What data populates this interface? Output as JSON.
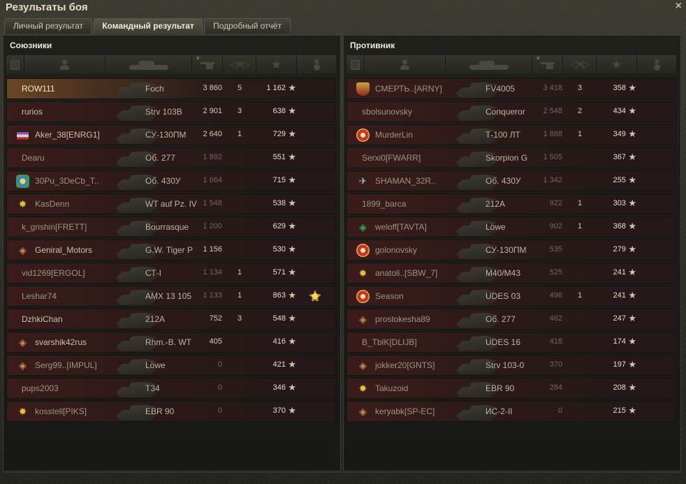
{
  "window": {
    "title": "Результаты боя",
    "close_icon": "×"
  },
  "tabs": [
    {
      "label": "Личный результат",
      "active": false
    },
    {
      "label": "Командный результат",
      "active": true
    },
    {
      "label": "Подробный отчёт",
      "active": false
    }
  ],
  "columns": {
    "icons": [
      "platoon-icon",
      "player-icon",
      "tank-icon",
      "damage-icon",
      "kills-icon",
      "experience-star-icon",
      "medal-icon"
    ],
    "sort_indicator": "˅",
    "kills_glyph": "◁✕▷",
    "star_glyph": "★"
  },
  "allies": {
    "title": "Союзники",
    "rows": [
      {
        "emblem": "",
        "name": "ROW111",
        "tank": "Foch",
        "damage": "3 860",
        "kills": "5",
        "xp": "1 162",
        "xp_star": "★",
        "medal": false,
        "style": "self"
      },
      {
        "emblem": "",
        "name": "rurios",
        "tank": "Strv 103B",
        "damage": "2 901",
        "kills": "3",
        "xp": "638",
        "xp_star": "★",
        "medal": false,
        "style": "alive"
      },
      {
        "emblem": "flag",
        "name": "Aker_38[ENRG1]",
        "tank": "СУ-130ПМ",
        "damage": "2 640",
        "kills": "1",
        "xp": "729",
        "xp_star": "★",
        "medal": false,
        "style": "alive"
      },
      {
        "emblem": "",
        "name": "Dearu",
        "tank": "Об. 277",
        "damage": "1 892",
        "kills": "",
        "xp": "551",
        "xp_star": "★",
        "medal": false,
        "style": "dead"
      },
      {
        "emblem": "shield",
        "name": "30Pu_3DeCb_T..",
        "tank": "Об. 430У",
        "damage": "1 664",
        "kills": "",
        "xp": "715",
        "xp_star": "★",
        "medal": false,
        "style": "dead"
      },
      {
        "emblem": "star",
        "name": "KasDenn",
        "tank": "WT auf Pz. IV",
        "damage": "1 548",
        "kills": "",
        "xp": "538",
        "xp_star": "★",
        "medal": false,
        "style": "dead"
      },
      {
        "emblem": "",
        "name": "k_grishin[FRETT]",
        "tank": "Bourrasque",
        "damage": "1 200",
        "kills": "",
        "xp": "629",
        "xp_star": "★",
        "medal": false,
        "style": "dead"
      },
      {
        "emblem": "diamond",
        "name": "Geniral_Motors",
        "tank": "G.W. Tiger P",
        "damage": "1 156",
        "kills": "",
        "xp": "530",
        "xp_star": "★",
        "medal": false,
        "style": "alive"
      },
      {
        "emblem": "",
        "name": "vid1269[ERGOL]",
        "tank": "СТ-I",
        "damage": "1 134",
        "kills": "1",
        "xp": "571",
        "xp_star": "★",
        "medal": false,
        "style": "dead"
      },
      {
        "emblem": "",
        "name": "Leshar74",
        "tank": "AMX 13 105",
        "damage": "1 133",
        "kills": "1",
        "xp": "863",
        "xp_star": "★",
        "medal": true,
        "style": "dead"
      },
      {
        "emblem": "",
        "name": "DzhkiChan",
        "tank": "212A",
        "damage": "752",
        "kills": "3",
        "xp": "548",
        "xp_star": "★",
        "medal": false,
        "style": "alive"
      },
      {
        "emblem": "diamond",
        "name": "svarshik42rus",
        "tank": "Rhm.-B. WT",
        "damage": "405",
        "kills": "",
        "xp": "416",
        "xp_star": "★",
        "medal": false,
        "style": "alive"
      },
      {
        "emblem": "diamond",
        "name": "Serg99..[IMPUL]",
        "tank": "Löwe",
        "damage": "0",
        "kills": "",
        "xp": "421",
        "xp_star": "★",
        "medal": false,
        "style": "dead"
      },
      {
        "emblem": "",
        "name": "pups2003",
        "tank": "T34",
        "damage": "0",
        "kills": "",
        "xp": "346",
        "xp_star": "★",
        "medal": false,
        "style": "dead"
      },
      {
        "emblem": "star",
        "name": "kosstell[PIKS]",
        "tank": "EBR 90",
        "damage": "0",
        "kills": "",
        "xp": "370",
        "xp_star": "★",
        "medal": false,
        "style": "dead"
      }
    ]
  },
  "enemies": {
    "title": "Противник",
    "rows": [
      {
        "emblem": "shield-red",
        "name": "СМЕРТЬ..[ARNY]",
        "tank": "FV4005",
        "damage": "3 418",
        "kills": "3",
        "xp": "358",
        "xp_star": "★",
        "medal": false,
        "style": "dead"
      },
      {
        "emblem": "",
        "name": "sbolsunovsky",
        "tank": "Conqueror",
        "damage": "2 548",
        "kills": "2",
        "xp": "434",
        "xp_star": "★",
        "medal": false,
        "style": "dead"
      },
      {
        "emblem": "round",
        "name": "MurderLin",
        "tank": "Т-100 ЛТ",
        "damage": "1 888",
        "kills": "1",
        "xp": "349",
        "xp_star": "★",
        "medal": false,
        "style": "dead"
      },
      {
        "emblem": "",
        "name": "Serxi0[FWARR]",
        "tank": "Skorpion G",
        "damage": "1 505",
        "kills": "",
        "xp": "367",
        "xp_star": "★",
        "medal": false,
        "style": "dead"
      },
      {
        "emblem": "bird",
        "name": "SHAMAN_32R..",
        "tank": "Об. 430У",
        "damage": "1 342",
        "kills": "",
        "xp": "255",
        "xp_star": "★",
        "medal": false,
        "style": "dead"
      },
      {
        "emblem": "",
        "name": "1899_barca",
        "tank": "212A",
        "damage": "922",
        "kills": "1",
        "xp": "303",
        "xp_star": "★",
        "medal": false,
        "style": "dead"
      },
      {
        "emblem": "green",
        "name": "weloff[TAVTA]",
        "tank": "Löwe",
        "damage": "902",
        "kills": "1",
        "xp": "368",
        "xp_star": "★",
        "medal": false,
        "style": "dead"
      },
      {
        "emblem": "round",
        "name": "golonovsky",
        "tank": "СУ-130ПМ",
        "damage": "535",
        "kills": "",
        "xp": "279",
        "xp_star": "★",
        "medal": false,
        "style": "dead"
      },
      {
        "emblem": "star",
        "name": "anatoli..[SBW_7]",
        "tank": "M40/M43",
        "damage": "525",
        "kills": "",
        "xp": "241",
        "xp_star": "★",
        "medal": false,
        "style": "dead"
      },
      {
        "emblem": "round",
        "name": "Season",
        "tank": "UDES 03",
        "damage": "496",
        "kills": "1",
        "xp": "241",
        "xp_star": "★",
        "medal": false,
        "style": "dead"
      },
      {
        "emblem": "diamond",
        "name": "prostokesha89",
        "tank": "Об. 277",
        "damage": "462",
        "kills": "",
        "xp": "247",
        "xp_star": "★",
        "medal": false,
        "style": "dead"
      },
      {
        "emblem": "",
        "name": "B_TblK[DLIJB]",
        "tank": "UDES 16",
        "damage": "418",
        "kills": "",
        "xp": "174",
        "xp_star": "★",
        "medal": false,
        "style": "dead"
      },
      {
        "emblem": "diamond",
        "name": "jokker20[GNTS]",
        "tank": "Strv 103-0",
        "damage": "370",
        "kills": "",
        "xp": "197",
        "xp_star": "★",
        "medal": false,
        "style": "dead"
      },
      {
        "emblem": "star",
        "name": "Takuzoid",
        "tank": "EBR 90",
        "damage": "284",
        "kills": "",
        "xp": "208",
        "xp_star": "★",
        "medal": false,
        "style": "dead"
      },
      {
        "emblem": "diamond",
        "name": "keryabk[SP-EC]",
        "tank": "ИС-2-II",
        "damage": "0",
        "kills": "",
        "xp": "215",
        "xp_star": "★",
        "medal": false,
        "style": "dead"
      }
    ]
  },
  "colors": {
    "ally_row": "#2a1918",
    "self_row": "#6b4625",
    "text": "#c8c0ab",
    "accent_sort": "#cdbd6d"
  }
}
